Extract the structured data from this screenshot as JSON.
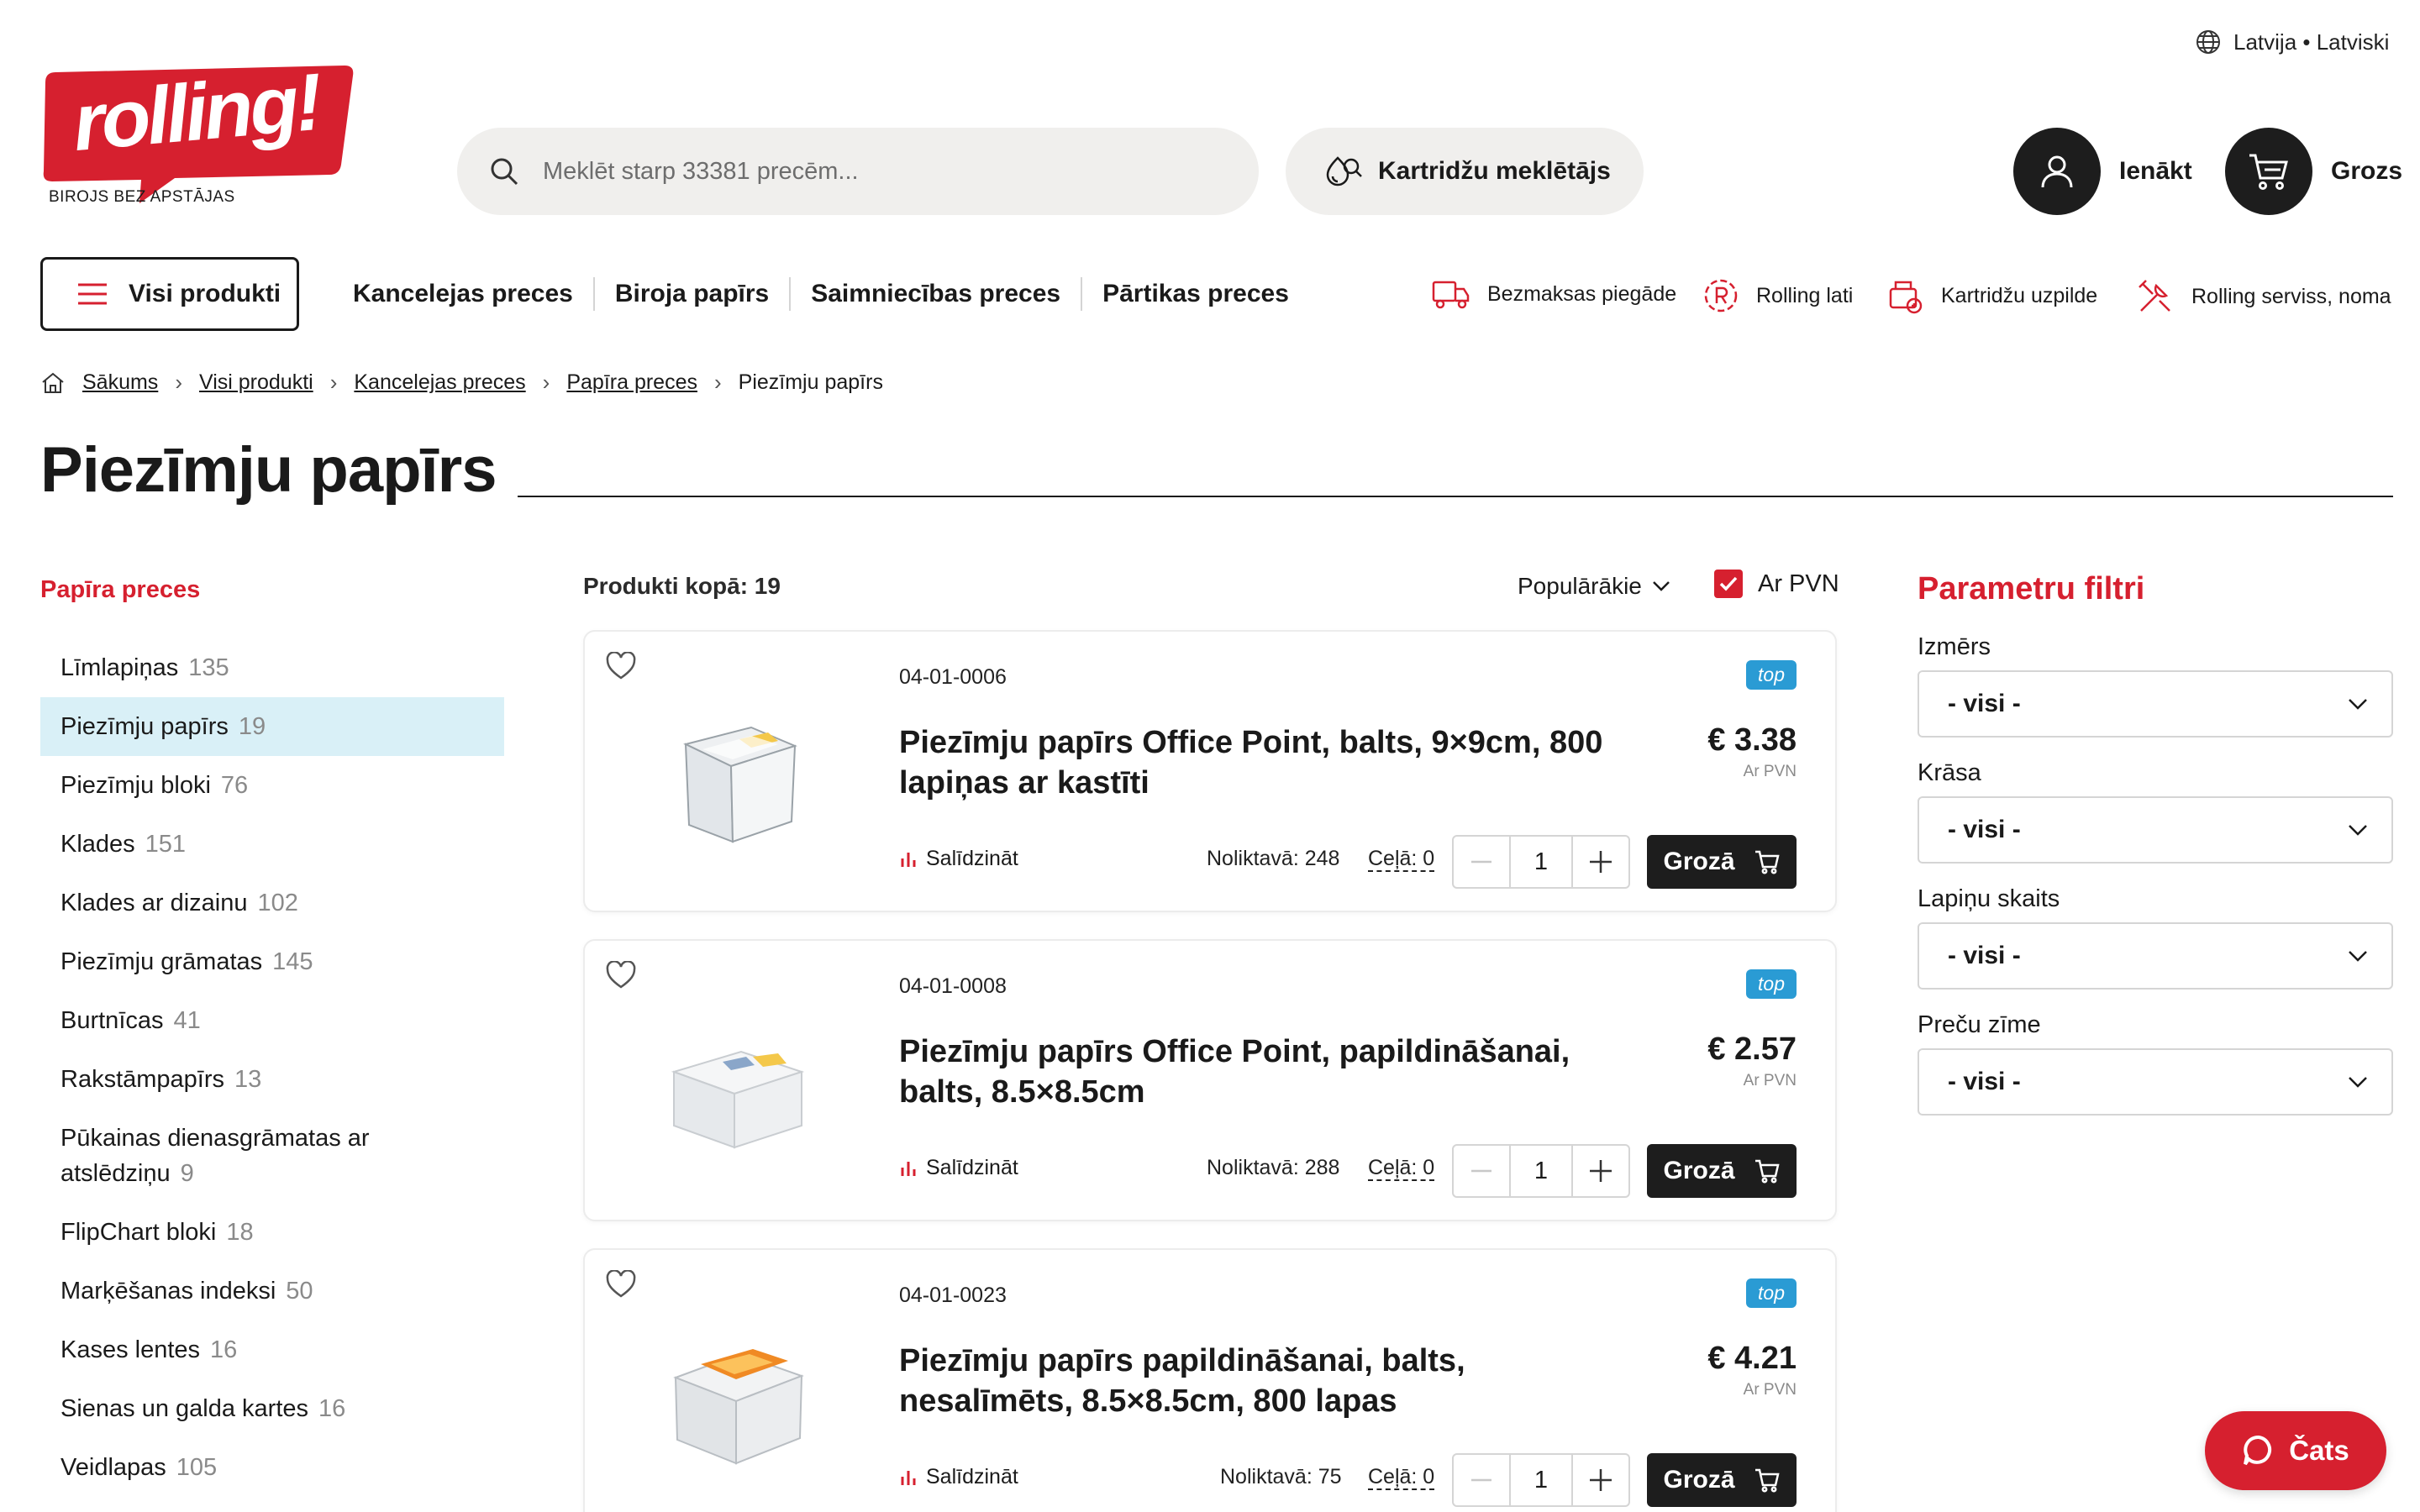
{
  "header": {
    "locale": "Latvija • Latviski",
    "logo_word": "rolling!",
    "logo_tagline": "BIROJS BEZ APSTĀJAS",
    "search_placeholder": "Meklēt starp 33381 precēm...",
    "cartridge_finder": "Kartridžu meklētājs",
    "login": "Ienākt",
    "cart": "Grozs"
  },
  "nav": {
    "all_products": "Visi produkti",
    "items": [
      "Kancelejas preces",
      "Biroja papīrs",
      "Saimniecības preces",
      "Pārtikas preces"
    ],
    "services": [
      {
        "label": "Bezmaksas piegāde",
        "icon": "delivery-truck-icon"
      },
      {
        "label": "Rolling lati",
        "icon": "rolling-lati-icon"
      },
      {
        "label": "Kartridžu uzpilde",
        "icon": "cartridge-refill-icon"
      },
      {
        "label": "Rolling serviss, noma",
        "icon": "service-tools-icon"
      }
    ]
  },
  "breadcrumb": [
    "Sākums",
    "Visi produkti",
    "Kancelejas preces",
    "Papīra preces",
    "Piezīmju papīrs"
  ],
  "page_title": "Piezīmju papīrs",
  "sidebar": {
    "heading": "Papīra preces",
    "items": [
      {
        "label": "Līmlapiņas",
        "count": "135"
      },
      {
        "label": "Piezīmju papīrs",
        "count": "19"
      },
      {
        "label": "Piezīmju bloki",
        "count": "76"
      },
      {
        "label": "Klades",
        "count": "151"
      },
      {
        "label": "Klades ar dizainu",
        "count": "102"
      },
      {
        "label": "Piezīmju grāmatas",
        "count": "145"
      },
      {
        "label": "Burtnīcas",
        "count": "41"
      },
      {
        "label": "Rakstāmpapīrs",
        "count": "13"
      },
      {
        "label": "Pūkainas dienasgrāmatas ar atslēdziņu",
        "count": "9"
      },
      {
        "label": "FlipChart bloki",
        "count": "18"
      },
      {
        "label": "Marķēšanas indeksi",
        "count": "50"
      },
      {
        "label": "Kases lentes",
        "count": "16"
      },
      {
        "label": "Sienas un galda kartes",
        "count": "16"
      },
      {
        "label": "Veidlapas",
        "count": "105"
      }
    ]
  },
  "listing": {
    "total": "Produkti kopā: 19",
    "sort": "Populārākie",
    "vat_label": "Ar PVN"
  },
  "products": [
    {
      "code": "04-01-0006",
      "badge": "top",
      "name": "Piezīmju papīrs Office Point, balts, 9×9cm, 800 lapiņas ar kastīti",
      "price": "€ 3.38",
      "price_note": "Ar PVN",
      "compare": "Salīdzināt",
      "stock": "Noliktavā: 248",
      "transit": "Ceļā: 0",
      "qty": "1",
      "add": "Grozā",
      "thumb": "cube-with-box"
    },
    {
      "code": "04-01-0008",
      "badge": "top",
      "name": "Piezīmju papīrs Office Point, papildināšanai, balts, 8.5×8.5cm",
      "price": "€ 2.57",
      "price_note": "Ar PVN",
      "compare": "Salīdzināt",
      "stock": "Noliktavā: 288",
      "transit": "Ceļā: 0",
      "qty": "1",
      "add": "Grozā",
      "thumb": "white-cube"
    },
    {
      "code": "04-01-0023",
      "badge": "top",
      "name": "Piezīmju papīrs papildināšanai, balts, nesalīmēts, 8.5×8.5cm, 800 lapas",
      "price": "€ 4.21",
      "price_note": "Ar PVN",
      "compare": "Salīdzināt",
      "stock": "Noliktavā: 75",
      "transit": "Ceļā: 0",
      "qty": "1",
      "add": "Grozā",
      "thumb": "wrapped-cube"
    }
  ],
  "filters": {
    "heading": "Parametru filtri",
    "groups": [
      {
        "label": "Izmērs",
        "value": "- visi -"
      },
      {
        "label": "Krāsa",
        "value": "- visi -"
      },
      {
        "label": "Lapiņu skaits",
        "value": "- visi -"
      },
      {
        "label": "Preču zīme",
        "value": "- visi -"
      }
    ]
  },
  "chat": "Čats",
  "colors": {
    "brand_red": "#d6202f",
    "badge_blue": "#2a9bd4",
    "active_bg": "#d9f0f7",
    "dark": "#1d1d1d"
  }
}
